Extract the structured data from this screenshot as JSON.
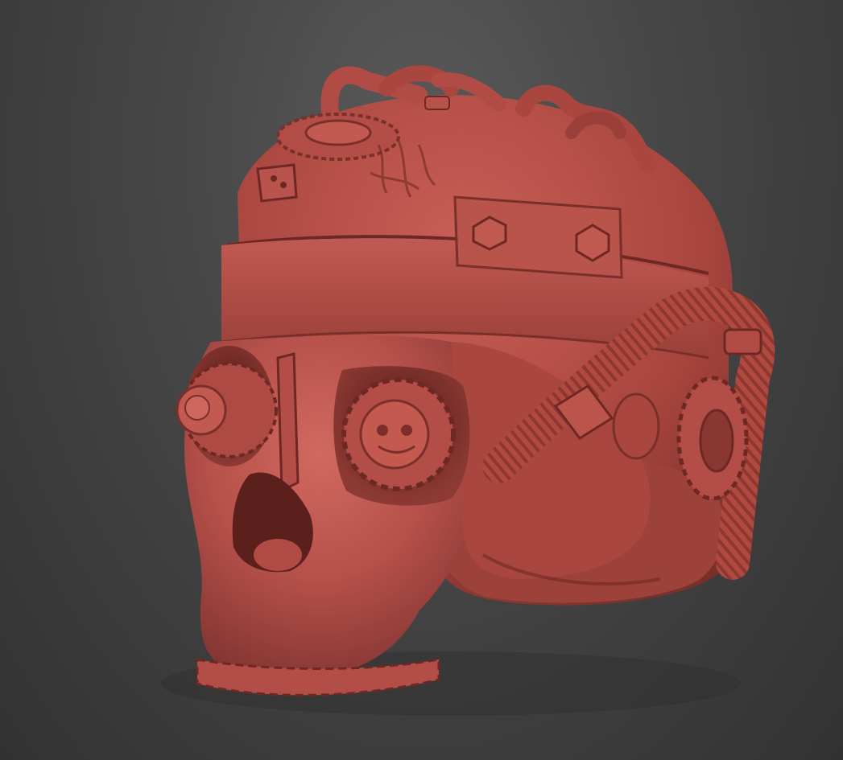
{
  "scene": {
    "subject": "steampunk-skull-sculpt",
    "colors": {
      "background_top": "#5a5a5a",
      "background_bottom": "#323232",
      "clay_base": "#b9524a",
      "clay_light": "#d06a60",
      "clay_shadow": "#7a2f2a",
      "clay_deep": "#4d1a17"
    }
  }
}
